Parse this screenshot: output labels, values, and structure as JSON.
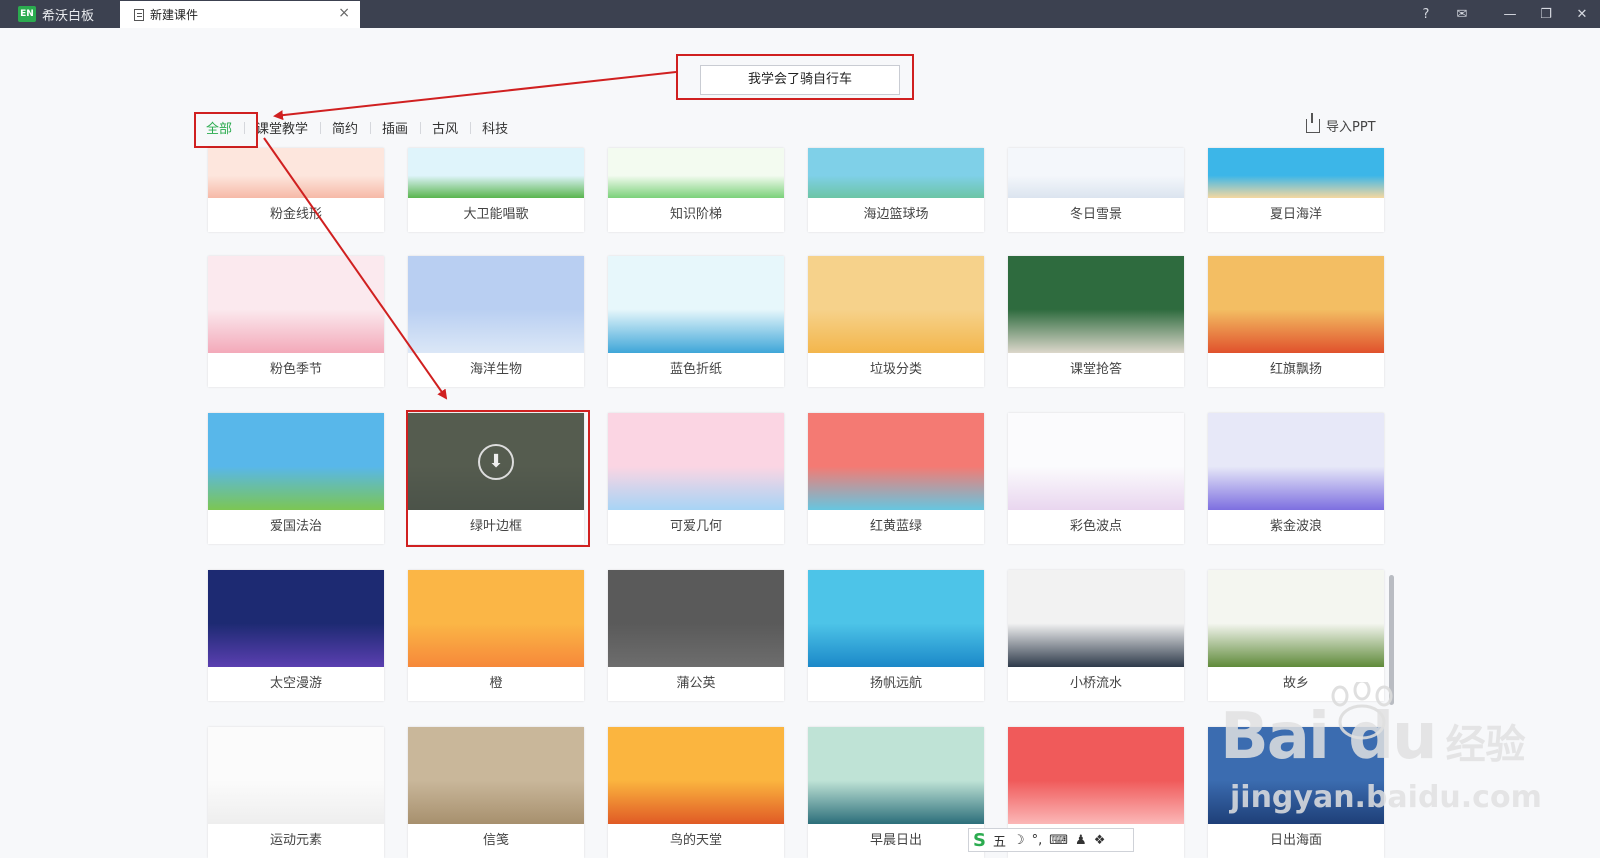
{
  "titlebar": {
    "app_logo": "EN",
    "app_name": "希沃白板",
    "doc_tab": "新建课件",
    "close": "×",
    "icons": [
      "help-icon",
      "mail-icon",
      "minimize-icon",
      "restore-icon",
      "close-icon"
    ],
    "controls": [
      "?",
      "✉",
      "—",
      "❐",
      "✕"
    ]
  },
  "title_input": {
    "value": "我学会了骑自行车"
  },
  "categories": [
    "全部",
    "课堂教学",
    "简约",
    "插画",
    "古风",
    "科技"
  ],
  "active_category": "全部",
  "import_ppt": "导入PPT",
  "templates": [
    {
      "name": "粉金线形",
      "colors": [
        "#fde6dd",
        "#f6b9a7"
      ]
    },
    {
      "name": "大卫能唱歌",
      "colors": [
        "#dff4fb",
        "#59b54e"
      ]
    },
    {
      "name": "知识阶梯",
      "colors": [
        "#f3fbf0",
        "#7bd17a"
      ]
    },
    {
      "name": "海边篮球场",
      "colors": [
        "#7fd0e8",
        "#6cc5a5"
      ]
    },
    {
      "name": "冬日雪景",
      "colors": [
        "#f4f7fb",
        "#dbe4ef"
      ]
    },
    {
      "name": "夏日海洋",
      "colors": [
        "#3cb6e8",
        "#f5d8a0"
      ]
    },
    {
      "name": "粉色季节",
      "colors": [
        "#fbe9ee",
        "#f3a9b9"
      ]
    },
    {
      "name": "海洋生物",
      "colors": [
        "#b9cff2",
        "#dbe7f7"
      ]
    },
    {
      "name": "蓝色折纸",
      "colors": [
        "#e7f7fb",
        "#3fa6d8"
      ]
    },
    {
      "name": "垃圾分类",
      "colors": [
        "#f6d28b",
        "#f3b64c"
      ]
    },
    {
      "name": "课堂抢答",
      "colors": [
        "#2e6b3e",
        "#dcd7cb"
      ]
    },
    {
      "name": "红旗飘扬",
      "colors": [
        "#f3be63",
        "#e0512c"
      ]
    },
    {
      "name": "爱国法治",
      "colors": [
        "#58b7ea",
        "#7cc653"
      ]
    },
    {
      "name": "绿叶边框",
      "colors": [
        "#9ad06a",
        "#4d8a3a"
      ]
    },
    {
      "name": "可爱几何",
      "colors": [
        "#fbd5e3",
        "#a7d4f5"
      ]
    },
    {
      "name": "红黄蓝绿",
      "colors": [
        "#f47a73",
        "#66c6e0"
      ]
    },
    {
      "name": "彩色波点",
      "colors": [
        "#fbfbfd",
        "#e9d6ef"
      ]
    },
    {
      "name": "紫金波浪",
      "colors": [
        "#e7e8f8",
        "#7d6fe0"
      ]
    },
    {
      "name": "太空漫游",
      "colors": [
        "#1d2a72",
        "#5a3fb0"
      ]
    },
    {
      "name": "橙",
      "colors": [
        "#fbb646",
        "#f6883a"
      ]
    },
    {
      "name": "蒲公英",
      "colors": [
        "#5a5a5a",
        "#6d6d6d"
      ]
    },
    {
      "name": "扬帆远航",
      "colors": [
        "#4dc4e8",
        "#1b88c8"
      ]
    },
    {
      "name": "小桥流水",
      "colors": [
        "#f2f2f2",
        "#2e3a4a"
      ]
    },
    {
      "name": "故乡",
      "colors": [
        "#f4f6f0",
        "#5f8a3a"
      ]
    },
    {
      "name": "运动元素",
      "colors": [
        "#fbfbfb",
        "#eeeeee"
      ]
    },
    {
      "name": "信笺",
      "colors": [
        "#c9b79a",
        "#a7906e"
      ]
    },
    {
      "name": "鸟的天堂",
      "colors": [
        "#fbb53f",
        "#e05a25"
      ]
    },
    {
      "name": "早晨日出",
      "colors": [
        "#bfe3d6",
        "#2c6e7a"
      ]
    },
    {
      "name": "",
      "colors": [
        "#f05a5a",
        "#fbb7b7"
      ]
    },
    {
      "name": "日出海面",
      "colors": [
        "#3b6cb0",
        "#1e3f78"
      ]
    }
  ],
  "selected_template": "绿叶边框",
  "download_icon": "⬇",
  "ime_bar": {
    "items": [
      "S",
      "五",
      "☽",
      "°,",
      "⌨",
      "♟",
      "❖"
    ]
  },
  "watermark": {
    "brand": "Bai du",
    "cn": "经验",
    "url": "jingyan.baidu.com"
  },
  "colors": {
    "accent": "#2bab4f",
    "annotation": "#d02020",
    "titlebar": "#3c4150"
  }
}
